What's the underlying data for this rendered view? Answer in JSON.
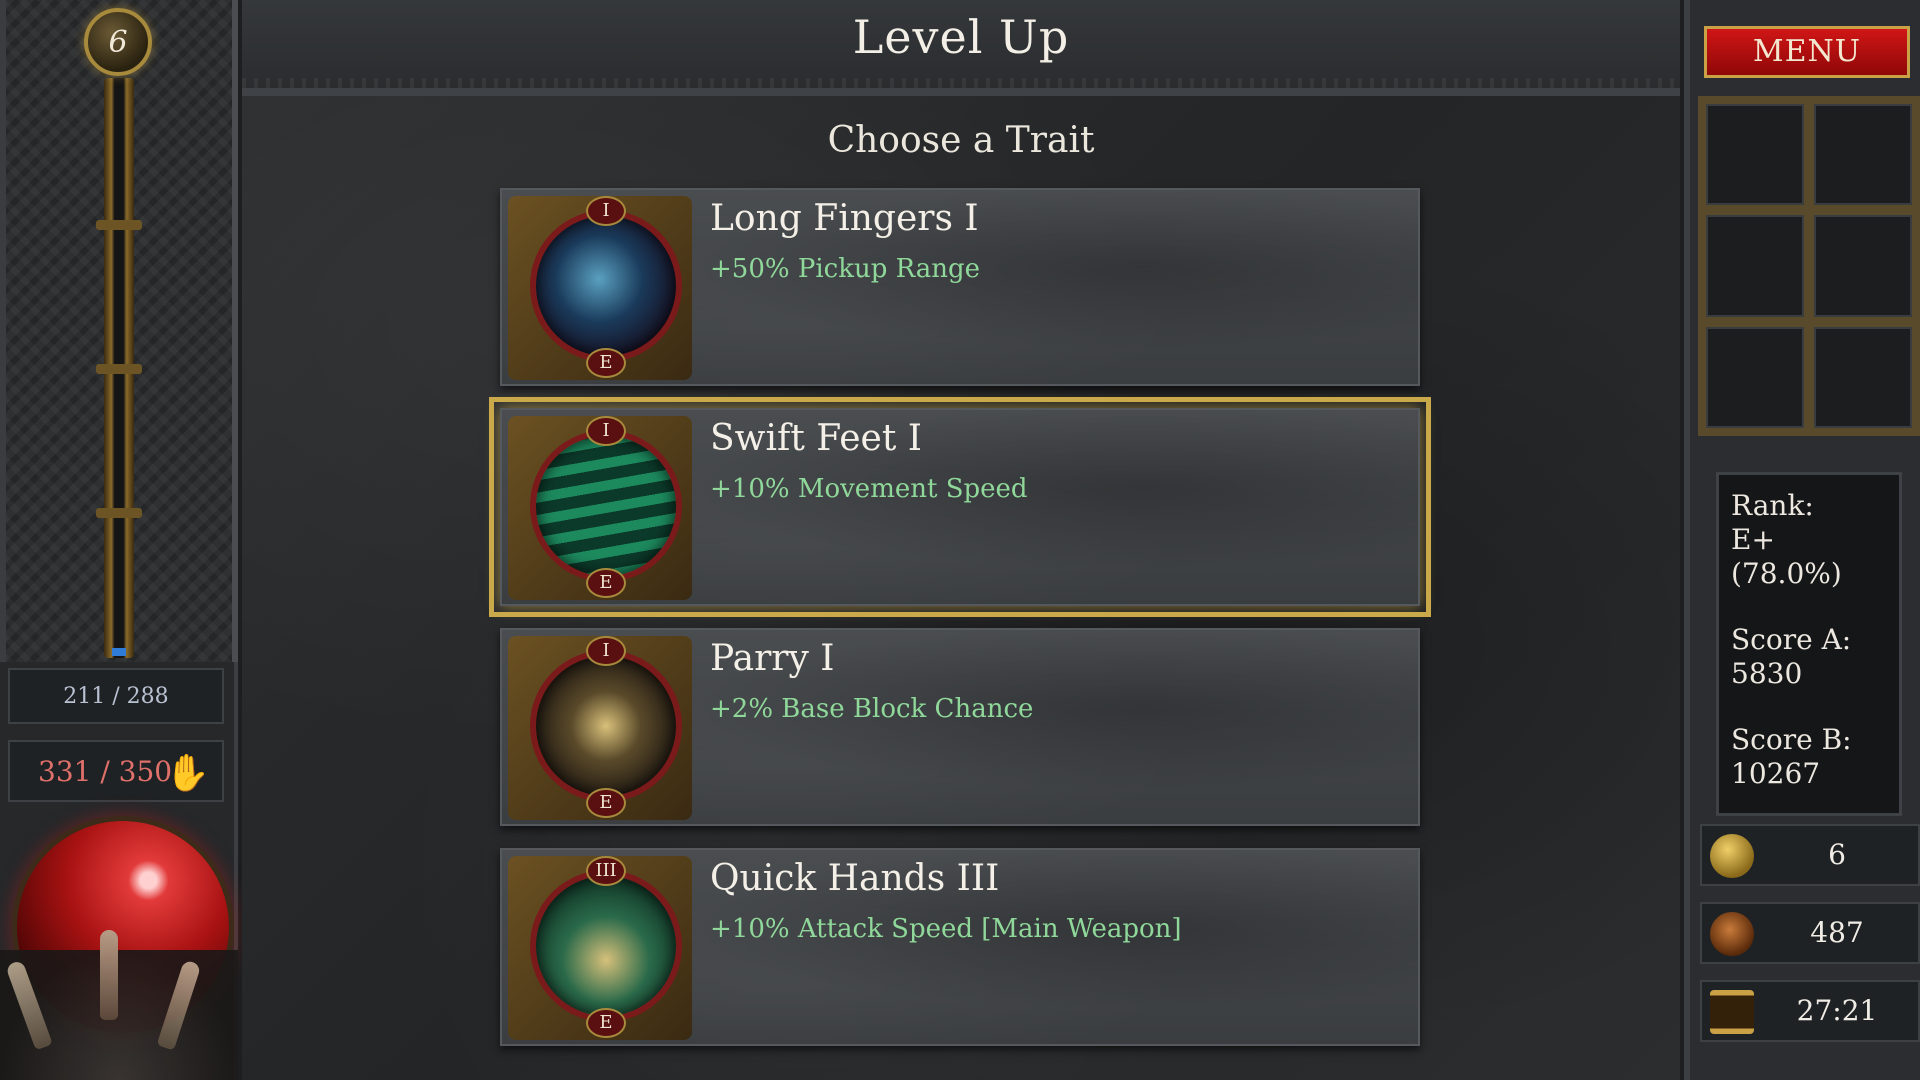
{
  "left_panel": {
    "level": "6",
    "xp_text": "211 / 288",
    "hp_text": "331 / 350",
    "xp_progress": 0.733,
    "hp_progress": 0.946
  },
  "header": {
    "title": "Level Up",
    "subtitle": "Choose a Trait"
  },
  "traits": [
    {
      "name": "Long Fingers I",
      "description": "+50% Pickup Range",
      "tier": "I",
      "rank": "E",
      "icon": "grabbing-hand-icon",
      "selected": false
    },
    {
      "name": "Swift Feet I",
      "description": "+10% Movement Speed",
      "tier": "I",
      "rank": "E",
      "icon": "running-figure-icon",
      "selected": true
    },
    {
      "name": "Parry I",
      "description": "+2% Base Block Chance",
      "tier": "I",
      "rank": "E",
      "icon": "crossed-swords-icon",
      "selected": false
    },
    {
      "name": "Quick Hands III",
      "description": "+10% Attack Speed [Main Weapon]",
      "tier": "III",
      "rank": "E",
      "icon": "claw-hands-icon",
      "selected": false
    }
  ],
  "right_panel": {
    "menu_label": "MENU",
    "stats": {
      "rank_label": "Rank:",
      "rank_value": "E+ (78.0%)",
      "score_a_label": "Score A:",
      "score_a_value": "5830",
      "score_b_label": "Score B:",
      "score_b_value": "10267"
    },
    "counters": {
      "gold": "6",
      "kills": "487",
      "time": "27:21"
    }
  },
  "colors": {
    "accent_gold": "#c9a94a",
    "desc_green": "#8fd89a",
    "menu_red": "#c01212",
    "hp_text": "#e0706a"
  }
}
